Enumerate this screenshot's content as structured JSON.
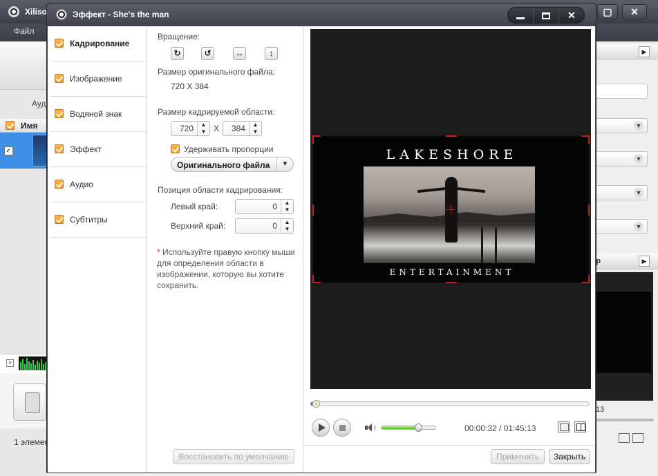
{
  "background_app": {
    "title": "Xiliso",
    "menu_file": "Файл",
    "tab_fragment": "Ауд",
    "list_header_name": "Имя",
    "status_fragment": "1 элемен",
    "right_header_fragment": "тр",
    "right_time_fragment": "13"
  },
  "dialog": {
    "title": "Эффект - She's the man",
    "categories": [
      {
        "label": "Кадрирование",
        "checked": true,
        "active": true
      },
      {
        "label": "Изображение",
        "checked": true,
        "active": false
      },
      {
        "label": "Водяной знак",
        "checked": true,
        "active": false
      },
      {
        "label": "Эффект",
        "checked": true,
        "active": false
      },
      {
        "label": "Аудио",
        "checked": true,
        "active": false
      },
      {
        "label": "Субтитры",
        "checked": true,
        "active": false
      }
    ],
    "crop": {
      "rotation_label": "Вращение:",
      "original_size_label": "Размер оригинального файла:",
      "original_size_value": "720 X 384",
      "crop_size_label": "Размер кадрируемой области:",
      "crop_width": "720",
      "crop_x_sep": "X",
      "crop_height": "384",
      "keep_ratio_label": "Удерживать пропорции",
      "keep_ratio_checked": true,
      "ratio_option": "Оригинального файла",
      "position_label": "Позиция области кадрирования:",
      "left_edge_label": "Левый край:",
      "left_edge_value": "0",
      "top_edge_label": "Верхний край:",
      "top_edge_value": "0",
      "note_star": "*",
      "note_text": " Используйте правую кнопку мыши для определения области в изображении, которую вы хотите сохранить.",
      "restore_default_label": "Восстановить по умолчанию"
    },
    "preview": {
      "logo_top": "LAKESHORE",
      "logo_bottom": "ENTERTAINMENT",
      "current_time": "00:00:32",
      "total_time": "01:45:13",
      "time_separator": " / ",
      "seek_progress": 0.005,
      "volume_level": 0.68
    },
    "footer": {
      "apply_label": "Применить",
      "close_label": "Закрыть"
    }
  },
  "colors": {
    "crop_marker": "#d01818",
    "checkbox": "#f29a1d",
    "volume_fill": "#4cc61e"
  }
}
